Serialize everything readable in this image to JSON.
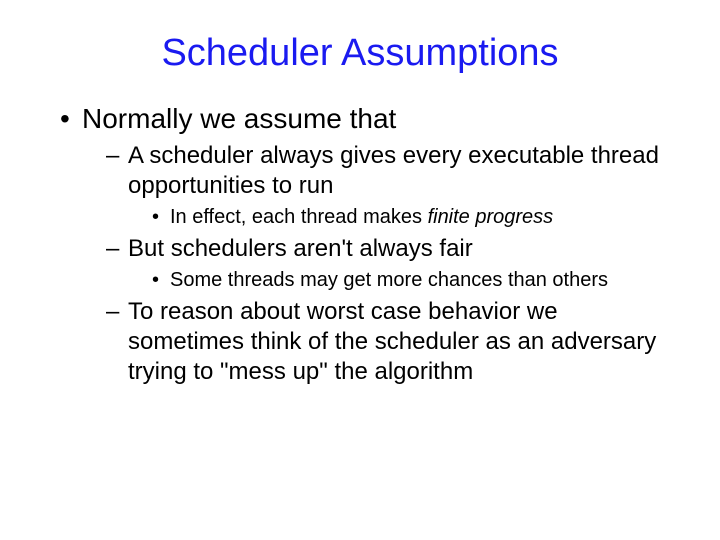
{
  "title": "Scheduler Assumptions",
  "b1": "Normally we assume that",
  "b1a": "A scheduler always gives every executable thread opportunities to run",
  "b1a1_pre": "In effect, each thread makes ",
  "b1a1_em": "finite progress",
  "b1b": "But schedulers aren't always fair",
  "b1b1": "Some threads may get more chances than others",
  "b1c": "To reason about worst case behavior we sometimes think of the scheduler as an adversary trying to \"mess up\" the algorithm"
}
